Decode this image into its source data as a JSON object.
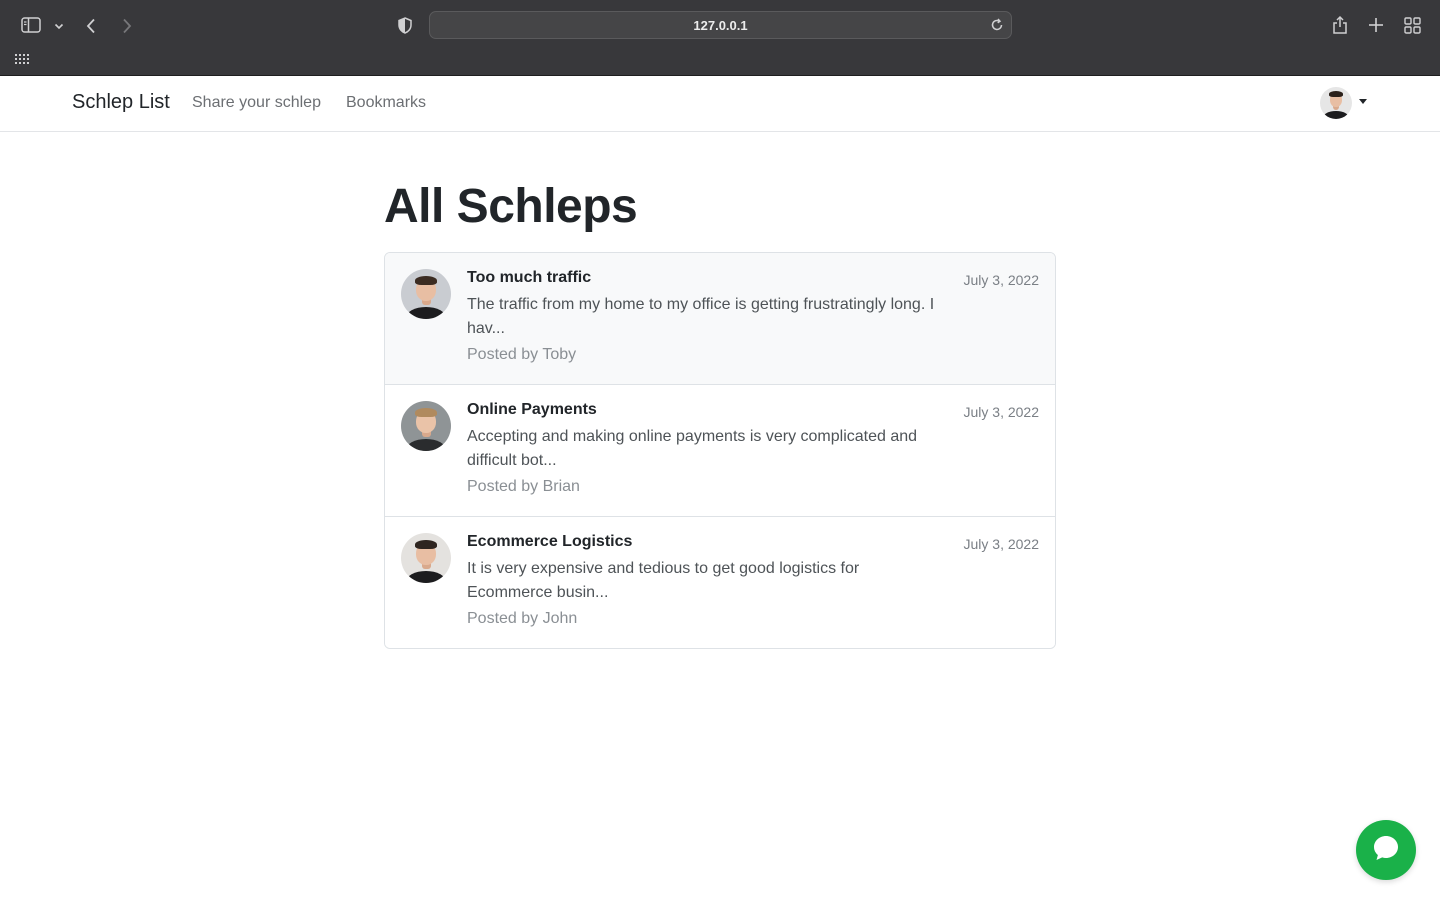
{
  "browser": {
    "url": "127.0.0.1"
  },
  "navbar": {
    "brand": "Schlep List",
    "links": [
      "Share your schlep",
      "Bookmarks"
    ]
  },
  "page": {
    "title": "All Schleps"
  },
  "schleps": [
    {
      "title": "Too much traffic",
      "date": "July 3, 2022",
      "excerpt": "The traffic from my home to my office is getting frustratingly long. I hav...",
      "author": "Posted by Toby"
    },
    {
      "title": "Online Payments",
      "date": "July 3, 2022",
      "excerpt": "Accepting and making online payments is very complicated and difficult bot...",
      "author": "Posted by Brian"
    },
    {
      "title": "Ecommerce Logistics",
      "date": "July 3, 2022",
      "excerpt": "It is very expensive and tedious to get good logistics for Ecommerce busin...",
      "author": "Posted by John"
    }
  ],
  "colors": {
    "chat_button": "#1ab149",
    "chrome": "#38383b"
  }
}
